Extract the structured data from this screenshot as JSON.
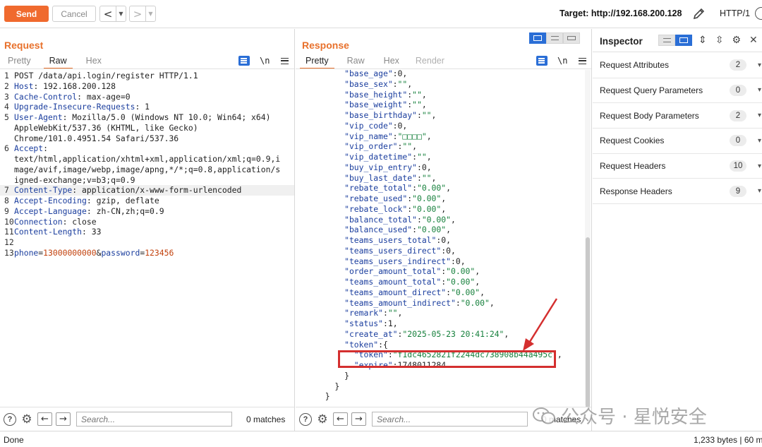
{
  "toolbar": {
    "send_label": "Send",
    "cancel_label": "Cancel",
    "back_arrow": "<",
    "forward_arrow": ">",
    "target_label": "Target: http://192.168.200.128",
    "http_version": "HTTP/1"
  },
  "request": {
    "title": "Request",
    "tabs": [
      "Pretty",
      "Raw",
      "Hex"
    ],
    "active_tab": "Raw",
    "newline_toggle": "\\n",
    "lines": [
      {
        "n": "1",
        "t": "POST /data/api.login/register HTTP/1.1"
      },
      {
        "n": "2",
        "h": "Host",
        "v": " 192.168.200.128"
      },
      {
        "n": "3",
        "h": "Cache-Control",
        "v": " max-age=0"
      },
      {
        "n": "4",
        "h": "Upgrade-Insecure-Requests",
        "v": " 1"
      },
      {
        "n": "5",
        "h": "User-Agent",
        "v": " Mozilla/5.0 (Windows NT 10.0; Win64; x64)"
      },
      {
        "n": "",
        "t": "AppleWebKit/537.36 (KHTML, like Gecko)"
      },
      {
        "n": "",
        "t": "Chrome/101.0.4951.54 Safari/537.36"
      },
      {
        "n": "6",
        "h": "Accept",
        "v": ""
      },
      {
        "n": "",
        "t": "text/html,application/xhtml+xml,application/xml;q=0.9,i"
      },
      {
        "n": "",
        "t": "mage/avif,image/webp,image/apng,*/*;q=0.8,application/s"
      },
      {
        "n": "",
        "t": "igned-exchange;v=b3;q=0.9"
      },
      {
        "n": "7",
        "h": "Content-Type",
        "v": " application/x-www-form-urlencoded",
        "highlight": true
      },
      {
        "n": "8",
        "h": "Accept-Encoding",
        "v": " gzip, deflate"
      },
      {
        "n": "9",
        "h": "Accept-Language",
        "v": " zh-CN,zh;q=0.9"
      },
      {
        "n": "10",
        "h": "Connection",
        "v": " close"
      },
      {
        "n": "11",
        "h": "Content-Length",
        "v": " 33"
      },
      {
        "n": "12",
        "t": ""
      },
      {
        "n": "13",
        "body": [
          {
            "k": "phone",
            "v": "13000000000"
          },
          {
            "k": "password",
            "v": "123456"
          }
        ]
      }
    ],
    "search_placeholder": "Search...",
    "matches": "0 matches"
  },
  "response": {
    "title": "Response",
    "tabs": [
      "Pretty",
      "Raw",
      "Hex",
      "Render"
    ],
    "active_tab": "Pretty",
    "newline_toggle": "\\n",
    "lines": [
      {
        "indent": 6,
        "k": "\"base_age\"",
        "sep": ":",
        "v": "0",
        "vt": "n",
        "end": ","
      },
      {
        "indent": 6,
        "k": "\"base_sex\"",
        "sep": ":",
        "v": "\"\"",
        "vt": "s",
        "end": ","
      },
      {
        "indent": 6,
        "k": "\"base_height\"",
        "sep": ":",
        "v": "\"\"",
        "vt": "s",
        "end": ","
      },
      {
        "indent": 6,
        "k": "\"base_weight\"",
        "sep": ":",
        "v": "\"\"",
        "vt": "s",
        "end": ","
      },
      {
        "indent": 6,
        "k": "\"base_birthday\"",
        "sep": ":",
        "v": "\"\"",
        "vt": "s",
        "end": ","
      },
      {
        "indent": 6,
        "k": "\"vip_code\"",
        "sep": ":",
        "v": "0",
        "vt": "n",
        "end": ","
      },
      {
        "indent": 6,
        "k": "\"vip_name\"",
        "sep": ":",
        "v": "\"□□□□\"",
        "vt": "s",
        "end": ","
      },
      {
        "indent": 6,
        "k": "\"vip_order\"",
        "sep": ":",
        "v": "\"\"",
        "vt": "s",
        "end": ","
      },
      {
        "indent": 6,
        "k": "\"vip_datetime\"",
        "sep": ":",
        "v": "\"\"",
        "vt": "s",
        "end": ","
      },
      {
        "indent": 6,
        "k": "\"buy_vip_entry\"",
        "sep": ":",
        "v": "0",
        "vt": "n",
        "end": ","
      },
      {
        "indent": 6,
        "k": "\"buy_last_date\"",
        "sep": ":",
        "v": "\"\"",
        "vt": "s",
        "end": ","
      },
      {
        "indent": 6,
        "k": "\"rebate_total\"",
        "sep": ":",
        "v": "\"0.00\"",
        "vt": "s",
        "end": ","
      },
      {
        "indent": 6,
        "k": "\"rebate_used\"",
        "sep": ":",
        "v": "\"0.00\"",
        "vt": "s",
        "end": ","
      },
      {
        "indent": 6,
        "k": "\"rebate_lock\"",
        "sep": ":",
        "v": "\"0.00\"",
        "vt": "s",
        "end": ","
      },
      {
        "indent": 6,
        "k": "\"balance_total\"",
        "sep": ":",
        "v": "\"0.00\"",
        "vt": "s",
        "end": ","
      },
      {
        "indent": 6,
        "k": "\"balance_used\"",
        "sep": ":",
        "v": "\"0.00\"",
        "vt": "s",
        "end": ","
      },
      {
        "indent": 6,
        "k": "\"teams_users_total\"",
        "sep": ":",
        "v": "0",
        "vt": "n",
        "end": ","
      },
      {
        "indent": 6,
        "k": "\"teams_users_direct\"",
        "sep": ":",
        "v": "0",
        "vt": "n",
        "end": ","
      },
      {
        "indent": 6,
        "k": "\"teams_users_indirect\"",
        "sep": ":",
        "v": "0",
        "vt": "n",
        "end": ","
      },
      {
        "indent": 6,
        "k": "\"order_amount_total\"",
        "sep": ":",
        "v": "\"0.00\"",
        "vt": "s",
        "end": ","
      },
      {
        "indent": 6,
        "k": "\"teams_amount_total\"",
        "sep": ":",
        "v": "\"0.00\"",
        "vt": "s",
        "end": ","
      },
      {
        "indent": 6,
        "k": "\"teams_amount_direct\"",
        "sep": ":",
        "v": "\"0.00\"",
        "vt": "s",
        "end": ","
      },
      {
        "indent": 6,
        "k": "\"teams_amount_indirect\"",
        "sep": ":",
        "v": "\"0.00\"",
        "vt": "s",
        "end": ","
      },
      {
        "indent": 6,
        "k": "\"remark\"",
        "sep": ":",
        "v": "\"\"",
        "vt": "s",
        "end": ","
      },
      {
        "indent": 6,
        "k": "\"status\"",
        "sep": ":",
        "v": "1",
        "vt": "n",
        "end": ","
      },
      {
        "indent": 6,
        "k": "\"create_at\"",
        "sep": ":",
        "v": "\"2025-05-23 20:41:24\"",
        "vt": "s",
        "end": ","
      },
      {
        "indent": 6,
        "k": "\"token\"",
        "sep": ":{",
        "v": "",
        "vt": "n",
        "end": ""
      },
      {
        "indent": 8,
        "k": "\"token\"",
        "sep": ":",
        "v": "\"f1dc4652821f2244dc738908b44a495c\"",
        "vt": "s",
        "end": ","
      },
      {
        "indent": 8,
        "k": "\"expire\"",
        "sep": ":",
        "v": "1748011284",
        "vt": "n",
        "end": ""
      },
      {
        "indent": 6,
        "k": "",
        "sep": "}",
        "v": "",
        "vt": "n",
        "end": ""
      },
      {
        "indent": 4,
        "k": "",
        "sep": "}",
        "v": "",
        "vt": "n",
        "end": ""
      },
      {
        "indent": 2,
        "k": "",
        "sep": "}",
        "v": "",
        "vt": "n",
        "end": ""
      }
    ],
    "search_placeholder": "Search...",
    "matches": "0 matches"
  },
  "inspector": {
    "title": "Inspector",
    "rows": [
      {
        "label": "Request Attributes",
        "count": "2"
      },
      {
        "label": "Request Query Parameters",
        "count": "0"
      },
      {
        "label": "Request Body Parameters",
        "count": "2"
      },
      {
        "label": "Request Cookies",
        "count": "0"
      },
      {
        "label": "Request Headers",
        "count": "10"
      },
      {
        "label": "Response Headers",
        "count": "9"
      }
    ]
  },
  "status": {
    "left": "Done",
    "right": "1,233 bytes | 60 mi"
  },
  "watermark": {
    "text": "公众号 · 星悦安全"
  },
  "colors": {
    "accent": "#f06a2e",
    "blue": "#2a6ed6",
    "annotation": "#d42f2f",
    "json_key": "#1b3e9e",
    "json_string": "#16803c"
  }
}
